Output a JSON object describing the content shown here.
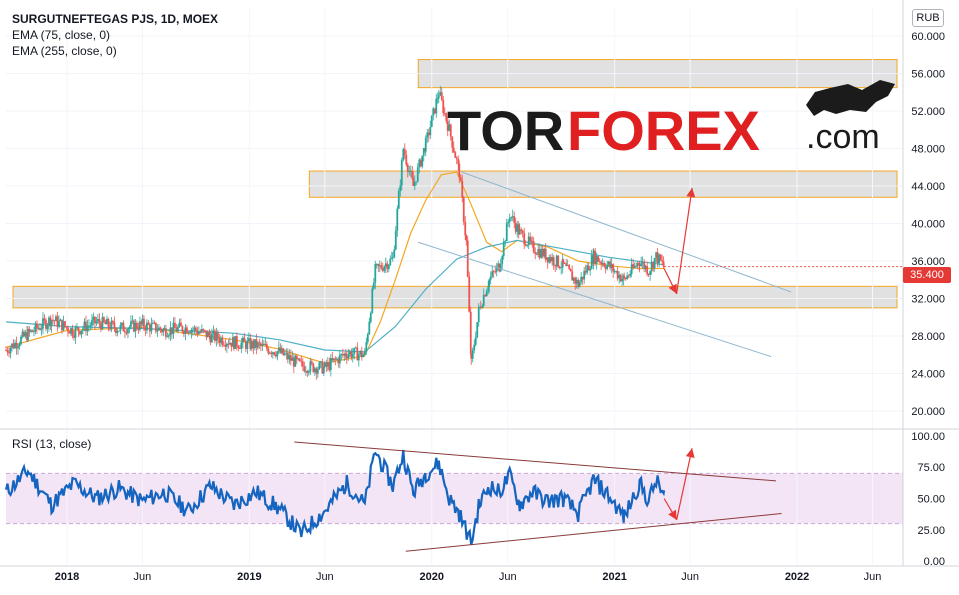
{
  "header": {
    "symbol_line": "SURGUTNEFTEGAS PJS, 1D, MOEX",
    "ema_fast": "EMA (75, close, 0)",
    "ema_slow": "EMA (255, close, 0)",
    "currency": "RUB"
  },
  "watermark": {
    "part1": "TOR",
    "part2": "FOREX",
    "part3": ".com"
  },
  "rsi_panel": {
    "title": "RSI (13, close)"
  },
  "last_price_label": "35.400",
  "colors": {
    "candle_up": "#26a69a",
    "candle_down": "#ef5350",
    "ema_fast": "#f5a623",
    "ema_slow": "#4fb0c6",
    "rsi_line": "#1565c0",
    "rsi_band": "#f3e5f5",
    "zone_fill": "#dcdcdc",
    "zone_border": "#f5a623",
    "channel": "#90b7cf",
    "rsi_trend": "#8b3a3a",
    "arrow": "#e53935",
    "logo_dark": "#1b1b1b",
    "logo_red": "#e02020"
  },
  "chart_data": [
    {
      "type": "candlestick",
      "title": "SURGUTNEFTEGAS PJS, 1D, MOEX",
      "x_tick_labels": [
        "2018",
        "Jun",
        "2019",
        "Jun",
        "2020",
        "Jun",
        "2021",
        "Jun",
        "2022",
        "Jun"
      ],
      "x_range": [
        "2017-09",
        "2022-08"
      ],
      "y_tick_labels": [
        "20.000",
        "24.000",
        "28.000",
        "32.000",
        "36.000",
        "40.000",
        "44.000",
        "48.000",
        "52.000",
        "56.000",
        "60.000"
      ],
      "ylim": [
        18.5,
        63
      ],
      "series": [
        {
          "name": "close",
          "points": [
            [
              "2017-09-01",
              26.5
            ],
            [
              "2017-10-15",
              28.2
            ],
            [
              "2017-12-01",
              29.8
            ],
            [
              "2018-01-15",
              28.5
            ],
            [
              "2018-03-01",
              29.5
            ],
            [
              "2018-04-15",
              28.8
            ],
            [
              "2018-06-01",
              29.2
            ],
            [
              "2018-07-15",
              28.6
            ],
            [
              "2018-09-01",
              28.9
            ],
            [
              "2018-10-15",
              28.0
            ],
            [
              "2018-12-01",
              27.3
            ],
            [
              "2019-01-15",
              27.0
            ],
            [
              "2019-03-01",
              26.3
            ],
            [
              "2019-04-15",
              24.8
            ],
            [
              "2019-06-01",
              24.6
            ],
            [
              "2019-07-15",
              26.2
            ],
            [
              "2019-08-20",
              26.0
            ],
            [
              "2019-09-10",
              35.0
            ],
            [
              "2019-10-15",
              36.2
            ],
            [
              "2019-11-05",
              48.0
            ],
            [
              "2019-11-25",
              44.0
            ],
            [
              "2019-12-20",
              48.5
            ],
            [
              "2020-01-15",
              54.0
            ],
            [
              "2020-02-05",
              50.0
            ],
            [
              "2020-02-25",
              45.5
            ],
            [
              "2020-03-10",
              38.0
            ],
            [
              "2020-03-20",
              25.0
            ],
            [
              "2020-04-05",
              31.0
            ],
            [
              "2020-04-25",
              34.0
            ],
            [
              "2020-05-15",
              35.5
            ],
            [
              "2020-06-05",
              41.0
            ],
            [
              "2020-06-25",
              39.0
            ],
            [
              "2020-07-20",
              37.5
            ],
            [
              "2020-08-20",
              36.5
            ],
            [
              "2020-09-20",
              35.5
            ],
            [
              "2020-10-20",
              33.5
            ],
            [
              "2020-11-20",
              36.5
            ],
            [
              "2020-12-20",
              35.5
            ],
            [
              "2021-01-20",
              34.0
            ],
            [
              "2021-02-20",
              36.0
            ],
            [
              "2021-03-10",
              35.0
            ],
            [
              "2021-03-25",
              36.5
            ],
            [
              "2021-04-10",
              35.4
            ]
          ]
        },
        {
          "name": "EMA (75, close, 0)",
          "points": [
            [
              "2017-09-01",
              26.8
            ],
            [
              "2018-01-01",
              28.6
            ],
            [
              "2018-06-01",
              28.9
            ],
            [
              "2018-12-01",
              27.6
            ],
            [
              "2019-03-01",
              26.6
            ],
            [
              "2019-06-01",
              25.1
            ],
            [
              "2019-08-20",
              25.9
            ],
            [
              "2019-09-20",
              29.5
            ],
            [
              "2019-10-20",
              34.0
            ],
            [
              "2019-11-20",
              39.0
            ],
            [
              "2019-12-20",
              42.5
            ],
            [
              "2020-01-20",
              45.2
            ],
            [
              "2020-02-20",
              45.5
            ],
            [
              "2020-03-20",
              42.0
            ],
            [
              "2020-04-20",
              38.0
            ],
            [
              "2020-05-20",
              37.0
            ],
            [
              "2020-06-20",
              38.2
            ],
            [
              "2020-08-20",
              37.5
            ],
            [
              "2020-10-20",
              36.0
            ],
            [
              "2020-12-20",
              35.5
            ],
            [
              "2021-02-20",
              35.2
            ],
            [
              "2021-04-10",
              35.2
            ]
          ]
        },
        {
          "name": "EMA (255, close, 0)",
          "points": [
            [
              "2017-09-01",
              29.5
            ],
            [
              "2018-01-01",
              29.0
            ],
            [
              "2018-06-01",
              28.8
            ],
            [
              "2018-12-01",
              28.3
            ],
            [
              "2019-03-01",
              27.6
            ],
            [
              "2019-06-01",
              26.5
            ],
            [
              "2019-08-20",
              26.3
            ],
            [
              "2019-10-20",
              29.0
            ],
            [
              "2019-12-20",
              33.0
            ],
            [
              "2020-02-20",
              36.2
            ],
            [
              "2020-04-20",
              37.5
            ],
            [
              "2020-06-20",
              38.2
            ],
            [
              "2020-09-20",
              37.3
            ],
            [
              "2020-12-20",
              36.4
            ],
            [
              "2021-04-10",
              35.6
            ]
          ]
        }
      ],
      "annotations": {
        "zones": [
          {
            "from": "2019-12-05",
            "to": "2022-07-20",
            "low": 54.5,
            "high": 57.5
          },
          {
            "from": "2019-05-01",
            "to": "2022-07-20",
            "low": 42.8,
            "high": 45.6
          },
          {
            "from": "2017-09-15",
            "to": "2022-07-20",
            "low": 31.0,
            "high": 33.3
          }
        ],
        "channel_lines": [
          {
            "from": [
              "2020-03-01",
              45.5
            ],
            "to": [
              "2021-12-20",
              32.7
            ]
          },
          {
            "from": [
              "2019-12-05",
              38.0
            ],
            "to": [
              "2021-11-10",
              25.8
            ]
          }
        ],
        "forecast_arrows": [
          {
            "from": [
              "2021-04-10",
              35.2
            ],
            "to": [
              "2021-05-05",
              32.5
            ]
          },
          {
            "from": [
              "2021-05-05",
              32.5
            ],
            "to": [
              "2021-06-05",
              43.8
            ]
          }
        ]
      }
    },
    {
      "type": "line",
      "title": "RSI (13, close)",
      "y_tick_labels": [
        "0.00",
        "25.00",
        "50.00",
        "75.00",
        "100.00"
      ],
      "ylim": [
        -3,
        103
      ],
      "band": [
        30,
        70
      ],
      "series": [
        {
          "name": "RSI (13, close)",
          "points": [
            [
              "2017-09-01",
              55
            ],
            [
              "2017-10-15",
              72
            ],
            [
              "2017-12-01",
              45
            ],
            [
              "2018-01-15",
              62
            ],
            [
              "2018-03-01",
              50
            ],
            [
              "2018-04-15",
              58
            ],
            [
              "2018-06-01",
              48
            ],
            [
              "2018-07-15",
              55
            ],
            [
              "2018-09-01",
              40
            ],
            [
              "2018-10-15",
              60
            ],
            [
              "2018-12-01",
              45
            ],
            [
              "2019-01-15",
              55
            ],
            [
              "2019-03-01",
              42
            ],
            [
              "2019-04-15",
              22
            ],
            [
              "2019-06-01",
              40
            ],
            [
              "2019-07-15",
              62
            ],
            [
              "2019-08-20",
              45
            ],
            [
              "2019-09-10",
              88
            ],
            [
              "2019-10-15",
              60
            ],
            [
              "2019-11-05",
              85
            ],
            [
              "2019-11-25",
              55
            ],
            [
              "2019-12-20",
              70
            ],
            [
              "2020-01-15",
              78
            ],
            [
              "2020-02-05",
              50
            ],
            [
              "2020-02-25",
              38
            ],
            [
              "2020-03-20",
              15
            ],
            [
              "2020-04-05",
              45
            ],
            [
              "2020-04-25",
              60
            ],
            [
              "2020-05-15",
              55
            ],
            [
              "2020-06-05",
              68
            ],
            [
              "2020-06-25",
              45
            ],
            [
              "2020-07-20",
              55
            ],
            [
              "2020-08-20",
              48
            ],
            [
              "2020-09-20",
              50
            ],
            [
              "2020-10-20",
              38
            ],
            [
              "2020-11-20",
              65
            ],
            [
              "2020-12-20",
              52
            ],
            [
              "2021-01-20",
              35
            ],
            [
              "2021-02-20",
              62
            ],
            [
              "2021-03-10",
              48
            ],
            [
              "2021-03-25",
              64
            ],
            [
              "2021-04-10",
              52
            ]
          ]
        }
      ],
      "annotations": {
        "trend_lines": [
          {
            "from": [
              "2019-04-01",
              95
            ],
            "to": [
              "2021-11-20",
              64
            ]
          },
          {
            "from": [
              "2019-11-10",
              8
            ],
            "to": [
              "2021-12-01",
              38
            ]
          }
        ],
        "forecast_arrows": [
          {
            "from": [
              "2021-04-10",
              50
            ],
            "to": [
              "2021-05-05",
              33
            ]
          },
          {
            "from": [
              "2021-05-05",
              33
            ],
            "to": [
              "2021-06-05",
              90
            ]
          }
        ]
      }
    }
  ]
}
